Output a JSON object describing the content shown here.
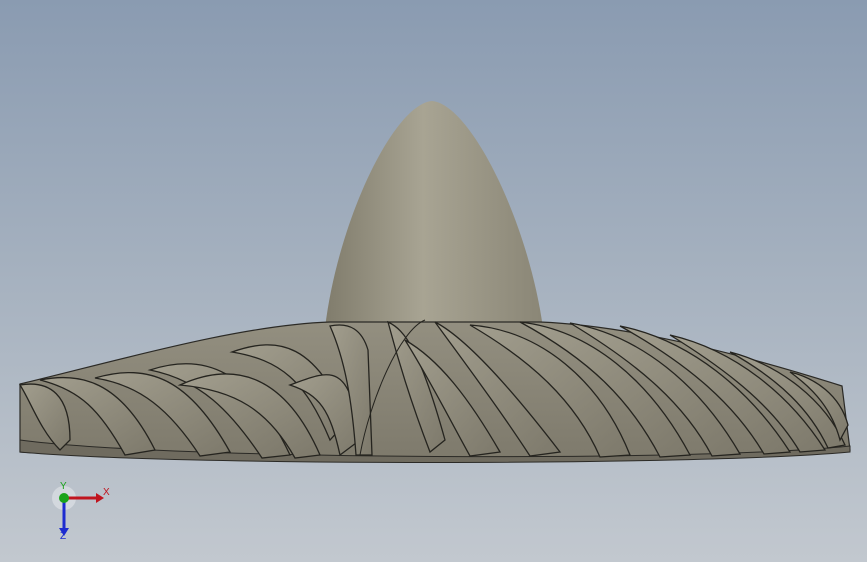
{
  "viewport": {
    "background_top": "#8a9bb1",
    "background_bottom": "#c2c8cf"
  },
  "model": {
    "icon": "impeller-model",
    "color": "#9e9a8a",
    "edge_color": "#2b2a26"
  },
  "triad": {
    "x_label": "X",
    "y_label": "Y",
    "z_label": "Z",
    "x_color": "#c0141e",
    "y_color": "#1aa31a",
    "z_color": "#1d2bd0"
  }
}
